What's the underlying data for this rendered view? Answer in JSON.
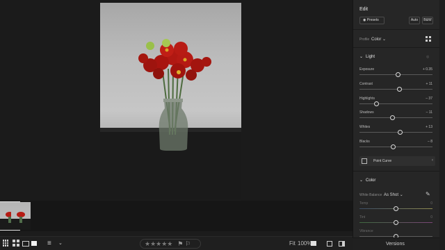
{
  "edit_panel": {
    "title": "Edit",
    "presets_label": "Presets",
    "auto_label": "Auto",
    "bw_label": "B&W",
    "profile_label": "Profile",
    "profile_value": "Color",
    "light_section": {
      "title": "Light",
      "sliders": [
        {
          "label": "Exposure",
          "value": "+ 0.35",
          "position": 0.53
        },
        {
          "label": "Contrast",
          "value": "+ 11",
          "position": 0.55
        },
        {
          "label": "Highlights",
          "value": "– 37",
          "position": 0.23
        },
        {
          "label": "Shadows",
          "value": "– 11",
          "position": 0.45
        },
        {
          "label": "Whites",
          "value": "+ 13",
          "position": 0.56
        },
        {
          "label": "Blacks",
          "value": "– 8",
          "position": 0.46
        }
      ]
    },
    "point_curve_label": "Point Curve",
    "color_section": {
      "title": "Color",
      "white_balance_label": "White Balance",
      "white_balance_value": "As Shot",
      "sliders": [
        {
          "label": "Temp",
          "value": "0",
          "position": 0.5
        },
        {
          "label": "Tint",
          "value": "0",
          "position": 0.5
        },
        {
          "label": "Vibrance",
          "value": "",
          "position": 0.5
        }
      ]
    }
  },
  "versions_label": "Versions",
  "bottom_bar": {
    "fit_label": "Fit",
    "zoom_value": "100%",
    "rating_stars": "★★★★★"
  },
  "colors": {
    "panel_bg": "#262626",
    "canvas_bg": "#1b1b1b",
    "accent": "#dcdcdc"
  }
}
